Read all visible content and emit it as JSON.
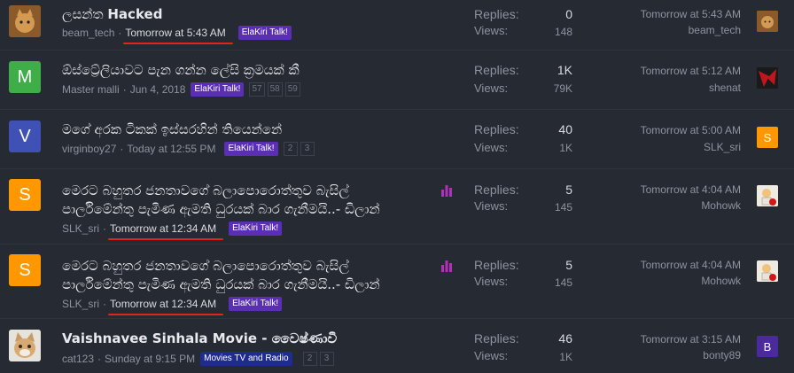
{
  "threads": [
    {
      "avatar_letter": "",
      "avatar_color": "#b07a3c",
      "title_prefix": "ලසන්ත",
      "title_bold": "Hacked",
      "title_line2": "",
      "author": "beam_tech",
      "time": "Tomorrow at 5:43 AM",
      "forum_label": "ElaKiri Talk!",
      "pages": [],
      "replies": "0",
      "views": "148",
      "last_time": "Tomorrow at 5:43 AM",
      "last_user": "beam_tech",
      "last_avatar_letter": "",
      "last_avatar_color": "#b07a3c"
    },
    {
      "avatar_letter": "M",
      "avatar_color": "#3fae49",
      "title_prefix": "ඕස්ට්‍රේලියාවට පැන ගන්න ලේසි ක්‍රමයක් කී",
      "title_bold": "",
      "title_line2": "",
      "author": "Master malli",
      "time": "Jun 4, 2018",
      "forum_label": "ElaKiri Talk!",
      "pages": [
        "57",
        "58",
        "59"
      ],
      "replies": "1K",
      "views": "79K",
      "last_time": "Tomorrow at 5:12 AM",
      "last_user": "shenat",
      "last_avatar_letter": "",
      "last_avatar_color": "#c0161c"
    },
    {
      "avatar_letter": "V",
      "avatar_color": "#3f51b5",
      "title_prefix": "මගේ අරක ටිකක් ඉස්සරහින් තියෙන්නේ",
      "title_bold": "",
      "title_line2": "",
      "author": "virginboy27",
      "time": "Today at 12:55 PM",
      "forum_label": "ElaKiri Talk!",
      "pages": [
        "2",
        "3"
      ],
      "replies": "40",
      "views": "1K",
      "last_time": "Tomorrow at 5:00 AM",
      "last_user": "SLK_sri",
      "last_avatar_letter": "S",
      "last_avatar_color": "#ff9800"
    },
    {
      "avatar_letter": "S",
      "avatar_color": "#ff9800",
      "title_prefix": "මෙරට බහුතර ජනතාවගේ බලාපොරොත්තුව බැසිල්",
      "title_bold": "",
      "title_line2": "පාර්ලිමේන්තු පැමිණ ඇමති ධුරයක් බාර ගැනීමයි..- ඩිලාන්",
      "author": "SLK_sri",
      "time": "Tomorrow at 12:34 AM",
      "forum_label": "ElaKiri Talk!",
      "pages": [],
      "replies": "5",
      "views": "145",
      "last_time": "Tomorrow at 4:04 AM",
      "last_user": "Mohowk",
      "last_avatar_letter": "",
      "last_avatar_color": "#e8e4d8"
    },
    {
      "avatar_letter": "S",
      "avatar_color": "#ff9800",
      "title_prefix": "මෙරට බහුතර ජනතාවගේ බලාපොරොත්තුව බැසිල්",
      "title_bold": "",
      "title_line2": "පාර්ලිමේන්තු පැමිණ ඇමති ධුරයක් බාර ගැනීමයි..- ඩිලාන්",
      "author": "SLK_sri",
      "time": "Tomorrow at 12:34 AM",
      "forum_label": "ElaKiri Talk!",
      "pages": [],
      "replies": "5",
      "views": "145",
      "last_time": "Tomorrow at 4:04 AM",
      "last_user": "Mohowk",
      "last_avatar_letter": "",
      "last_avatar_color": "#e8e4d8"
    },
    {
      "avatar_letter": "",
      "avatar_color": "#d9c8b0",
      "title_prefix": "",
      "title_bold": "Vaishnavee Sinhala Movie - වෛෂ්ණාවී",
      "title_line2": "",
      "author": "cat123",
      "time": "Sunday at 9:15 PM",
      "forum_label": "Movies TV and Radio",
      "pages": [
        "2",
        "3"
      ],
      "replies": "46",
      "views": "1K",
      "last_time": "Tomorrow at 3:15 AM",
      "last_user": "bonty89",
      "last_avatar_letter": "B",
      "last_avatar_color": "#4b2a9e"
    }
  ],
  "labels": {
    "replies": "Replies:",
    "views": "Views:"
  },
  "colors": {
    "background": "#262a33",
    "label_purple": "#5a2fb3",
    "label_navy": "#1e2b8f",
    "poll_icon": "#b32fb8",
    "highlight_underline": "#e0241e"
  }
}
